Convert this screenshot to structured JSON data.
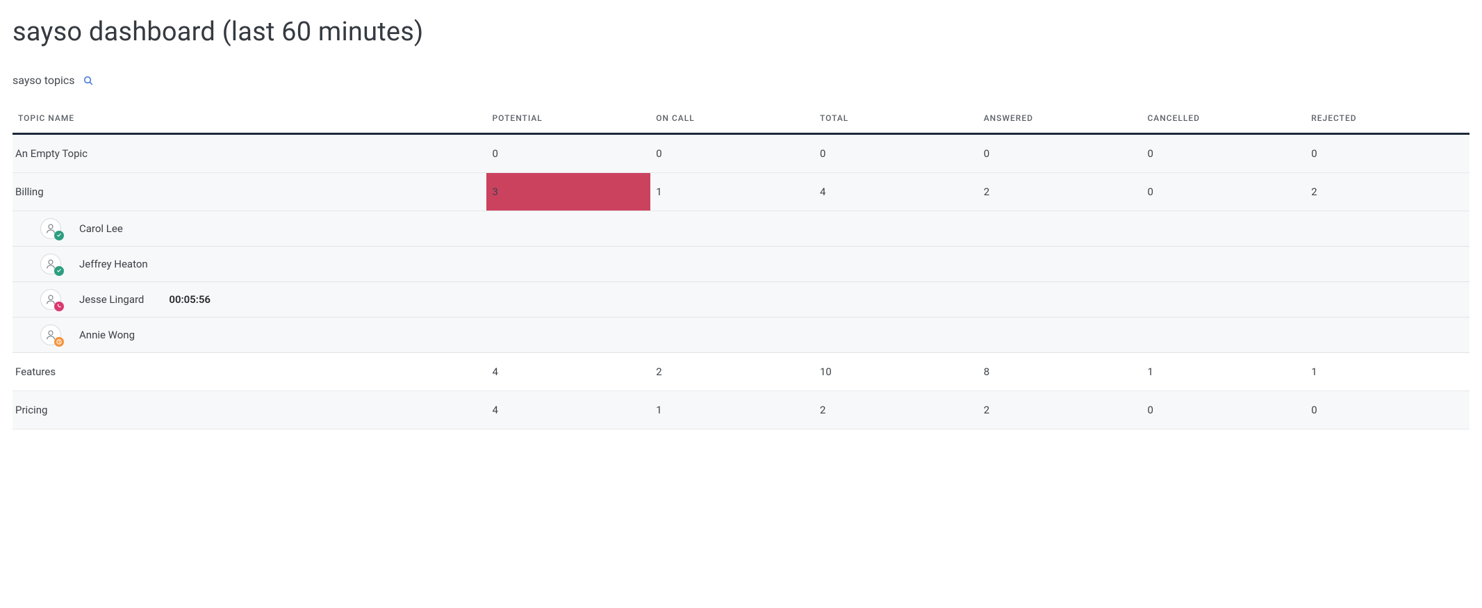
{
  "header": {
    "title": "sayso dashboard (last 60 minutes)",
    "subtitle": "sayso topics"
  },
  "columns": {
    "topic_name": "Topic Name",
    "potential": "Potential",
    "on_call": "On Call",
    "total": "Total",
    "answered": "Answered",
    "cancelled": "Cancelled",
    "rejected": "Rejected"
  },
  "topics": [
    {
      "name": "An Empty Topic",
      "potential": "0",
      "on_call": "0",
      "total": "0",
      "answered": "0",
      "cancelled": "0",
      "rejected": "0",
      "alt": true,
      "highlight_potential": false,
      "agents": []
    },
    {
      "name": "Billing",
      "potential": "3",
      "on_call": "1",
      "total": "4",
      "answered": "2",
      "cancelled": "0",
      "rejected": "2",
      "alt": true,
      "highlight_potential": true,
      "agents": [
        {
          "name": "Carol Lee",
          "status": "available",
          "timer": ""
        },
        {
          "name": "Jeffrey Heaton",
          "status": "available",
          "timer": ""
        },
        {
          "name": "Jesse Lingard",
          "status": "on-call",
          "timer": "00:05:56"
        },
        {
          "name": "Annie Wong",
          "status": "away",
          "timer": ""
        }
      ]
    },
    {
      "name": "Features",
      "potential": "4",
      "on_call": "2",
      "total": "10",
      "answered": "8",
      "cancelled": "1",
      "rejected": "1",
      "alt": false,
      "highlight_potential": false,
      "agents": []
    },
    {
      "name": "Pricing",
      "potential": "4",
      "on_call": "1",
      "total": "2",
      "answered": "2",
      "cancelled": "0",
      "rejected": "0",
      "alt": true,
      "highlight_potential": false,
      "agents": []
    }
  ]
}
